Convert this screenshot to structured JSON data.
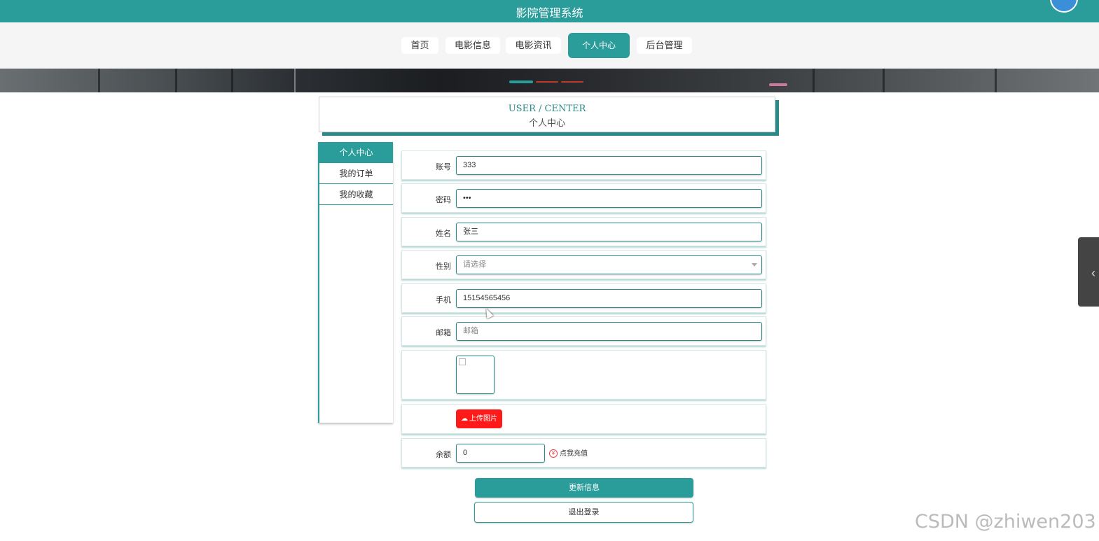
{
  "app": {
    "title": "影院管理系统"
  },
  "nav": {
    "items": [
      {
        "label": "首页"
      },
      {
        "label": "电影信息"
      },
      {
        "label": "电影资讯"
      },
      {
        "label": "个人中心"
      },
      {
        "label": "后台管理"
      }
    ],
    "active": "个人中心"
  },
  "header": {
    "en": "USER / CENTER",
    "cn": "个人中心"
  },
  "sidebar": {
    "items": [
      {
        "label": "个人中心"
      },
      {
        "label": "我的订单"
      },
      {
        "label": "我的收藏"
      }
    ],
    "active": "个人中心"
  },
  "form": {
    "account": {
      "label": "账号",
      "value": "333"
    },
    "password": {
      "label": "密码",
      "value": "•••"
    },
    "name": {
      "label": "姓名",
      "value": "张三"
    },
    "gender": {
      "label": "性别",
      "value": "请选择"
    },
    "phone": {
      "label": "手机",
      "value": "15154565456"
    },
    "email": {
      "label": "邮箱",
      "value": "邮箱"
    },
    "upload_label": "上传图片",
    "balance": {
      "label": "余额",
      "value": "0"
    },
    "recharge_label": "点我充值",
    "recharge_icon": "¥"
  },
  "buttons": {
    "update": "更新信息",
    "logout": "退出登录"
  },
  "watermark": "CSDN @zhiwen203",
  "colors": {
    "primary": "#2a9c9a",
    "upload": "#ff1a1a"
  }
}
